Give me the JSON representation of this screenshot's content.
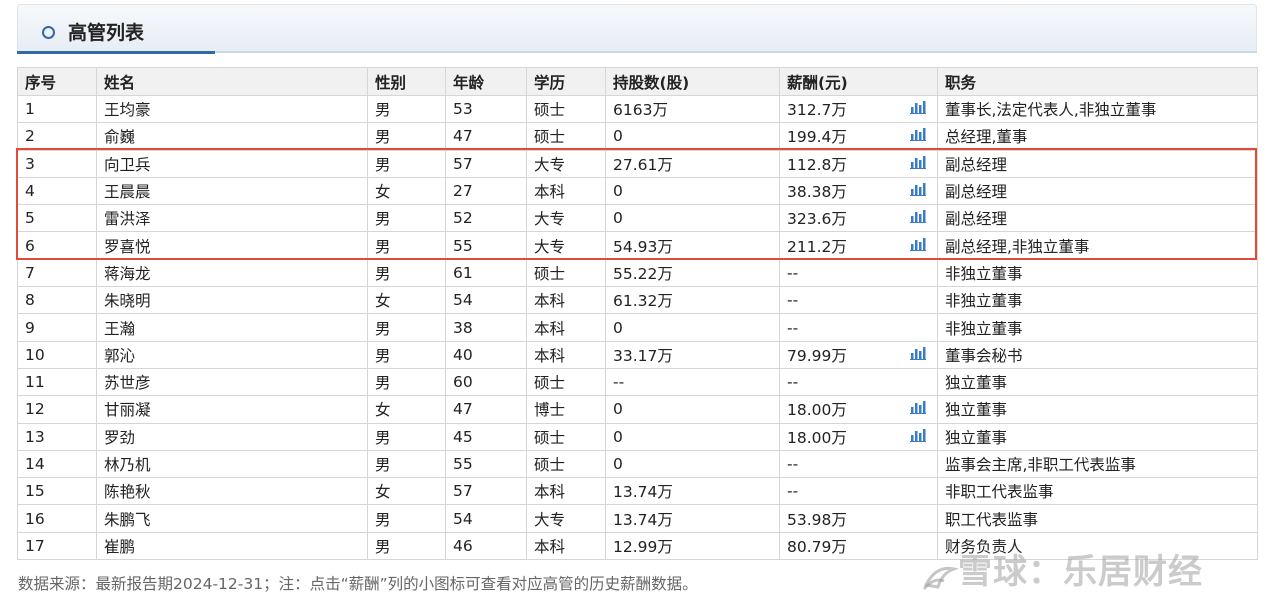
{
  "panel": {
    "title": "高管列表"
  },
  "table": {
    "headers": [
      "序号",
      "姓名",
      "性别",
      "年龄",
      "学历",
      "持股数(股)",
      "薪酬(元)",
      "职务"
    ],
    "rows": [
      {
        "no": "1",
        "name": "王均豪",
        "gender": "男",
        "age": "53",
        "edu": "硕士",
        "shares": "6163万",
        "salary": "312.7万",
        "chart": true,
        "title": "董事长,法定代表人,非独立董事"
      },
      {
        "no": "2",
        "name": "俞巍",
        "gender": "男",
        "age": "47",
        "edu": "硕士",
        "shares": "0",
        "salary": "199.4万",
        "chart": true,
        "title": "总经理,董事"
      },
      {
        "no": "3",
        "name": "向卫兵",
        "gender": "男",
        "age": "57",
        "edu": "大专",
        "shares": "27.61万",
        "salary": "112.8万",
        "chart": true,
        "title": "副总经理"
      },
      {
        "no": "4",
        "name": "王晨晨",
        "gender": "女",
        "age": "27",
        "edu": "本科",
        "shares": "0",
        "salary": "38.38万",
        "chart": true,
        "title": "副总经理"
      },
      {
        "no": "5",
        "name": "雷洪泽",
        "gender": "男",
        "age": "52",
        "edu": "大专",
        "shares": "0",
        "salary": "323.6万",
        "chart": true,
        "title": "副总经理"
      },
      {
        "no": "6",
        "name": "罗喜悦",
        "gender": "男",
        "age": "55",
        "edu": "大专",
        "shares": "54.93万",
        "salary": "211.2万",
        "chart": true,
        "title": "副总经理,非独立董事"
      },
      {
        "no": "7",
        "name": "蒋海龙",
        "gender": "男",
        "age": "61",
        "edu": "硕士",
        "shares": "55.22万",
        "salary": "--",
        "chart": false,
        "title": "非独立董事"
      },
      {
        "no": "8",
        "name": "朱晓明",
        "gender": "女",
        "age": "54",
        "edu": "本科",
        "shares": "61.32万",
        "salary": "--",
        "chart": false,
        "title": "非独立董事"
      },
      {
        "no": "9",
        "name": "王瀚",
        "gender": "男",
        "age": "38",
        "edu": "本科",
        "shares": "0",
        "salary": "--",
        "chart": false,
        "title": "非独立董事"
      },
      {
        "no": "10",
        "name": "郭沁",
        "gender": "男",
        "age": "40",
        "edu": "本科",
        "shares": "33.17万",
        "salary": "79.99万",
        "chart": true,
        "title": "董事会秘书"
      },
      {
        "no": "11",
        "name": "苏世彦",
        "gender": "男",
        "age": "60",
        "edu": "硕士",
        "shares": "--",
        "salary": "--",
        "chart": false,
        "title": "独立董事"
      },
      {
        "no": "12",
        "name": "甘丽凝",
        "gender": "女",
        "age": "47",
        "edu": "博士",
        "shares": "0",
        "salary": "18.00万",
        "chart": true,
        "title": "独立董事"
      },
      {
        "no": "13",
        "name": "罗劲",
        "gender": "男",
        "age": "45",
        "edu": "硕士",
        "shares": "0",
        "salary": "18.00万",
        "chart": true,
        "title": "独立董事"
      },
      {
        "no": "14",
        "name": "林乃机",
        "gender": "男",
        "age": "55",
        "edu": "硕士",
        "shares": "0",
        "salary": "--",
        "chart": false,
        "title": "监事会主席,非职工代表监事"
      },
      {
        "no": "15",
        "name": "陈艳秋",
        "gender": "女",
        "age": "57",
        "edu": "本科",
        "shares": "13.74万",
        "salary": "--",
        "chart": false,
        "title": "非职工代表监事"
      },
      {
        "no": "16",
        "name": "朱鹏飞",
        "gender": "男",
        "age": "54",
        "edu": "大专",
        "shares": "13.74万",
        "salary": "53.98万",
        "chart": false,
        "title": "职工代表监事"
      },
      {
        "no": "17",
        "name": "崔鹏",
        "gender": "男",
        "age": "46",
        "edu": "本科",
        "shares": "12.99万",
        "salary": "80.79万",
        "chart": false,
        "title": "财务负责人"
      }
    ]
  },
  "footnote": "数据来源：最新报告期2024-12-31；注：点击“薪酬”列的小图标可查看对应高管的历史薪酬数据。",
  "watermark": "雪球：乐居财经",
  "colors": {
    "accent": "#2f6aa6",
    "highlight_border": "#e24a3b",
    "chart_icon": "#3a7cc3"
  }
}
